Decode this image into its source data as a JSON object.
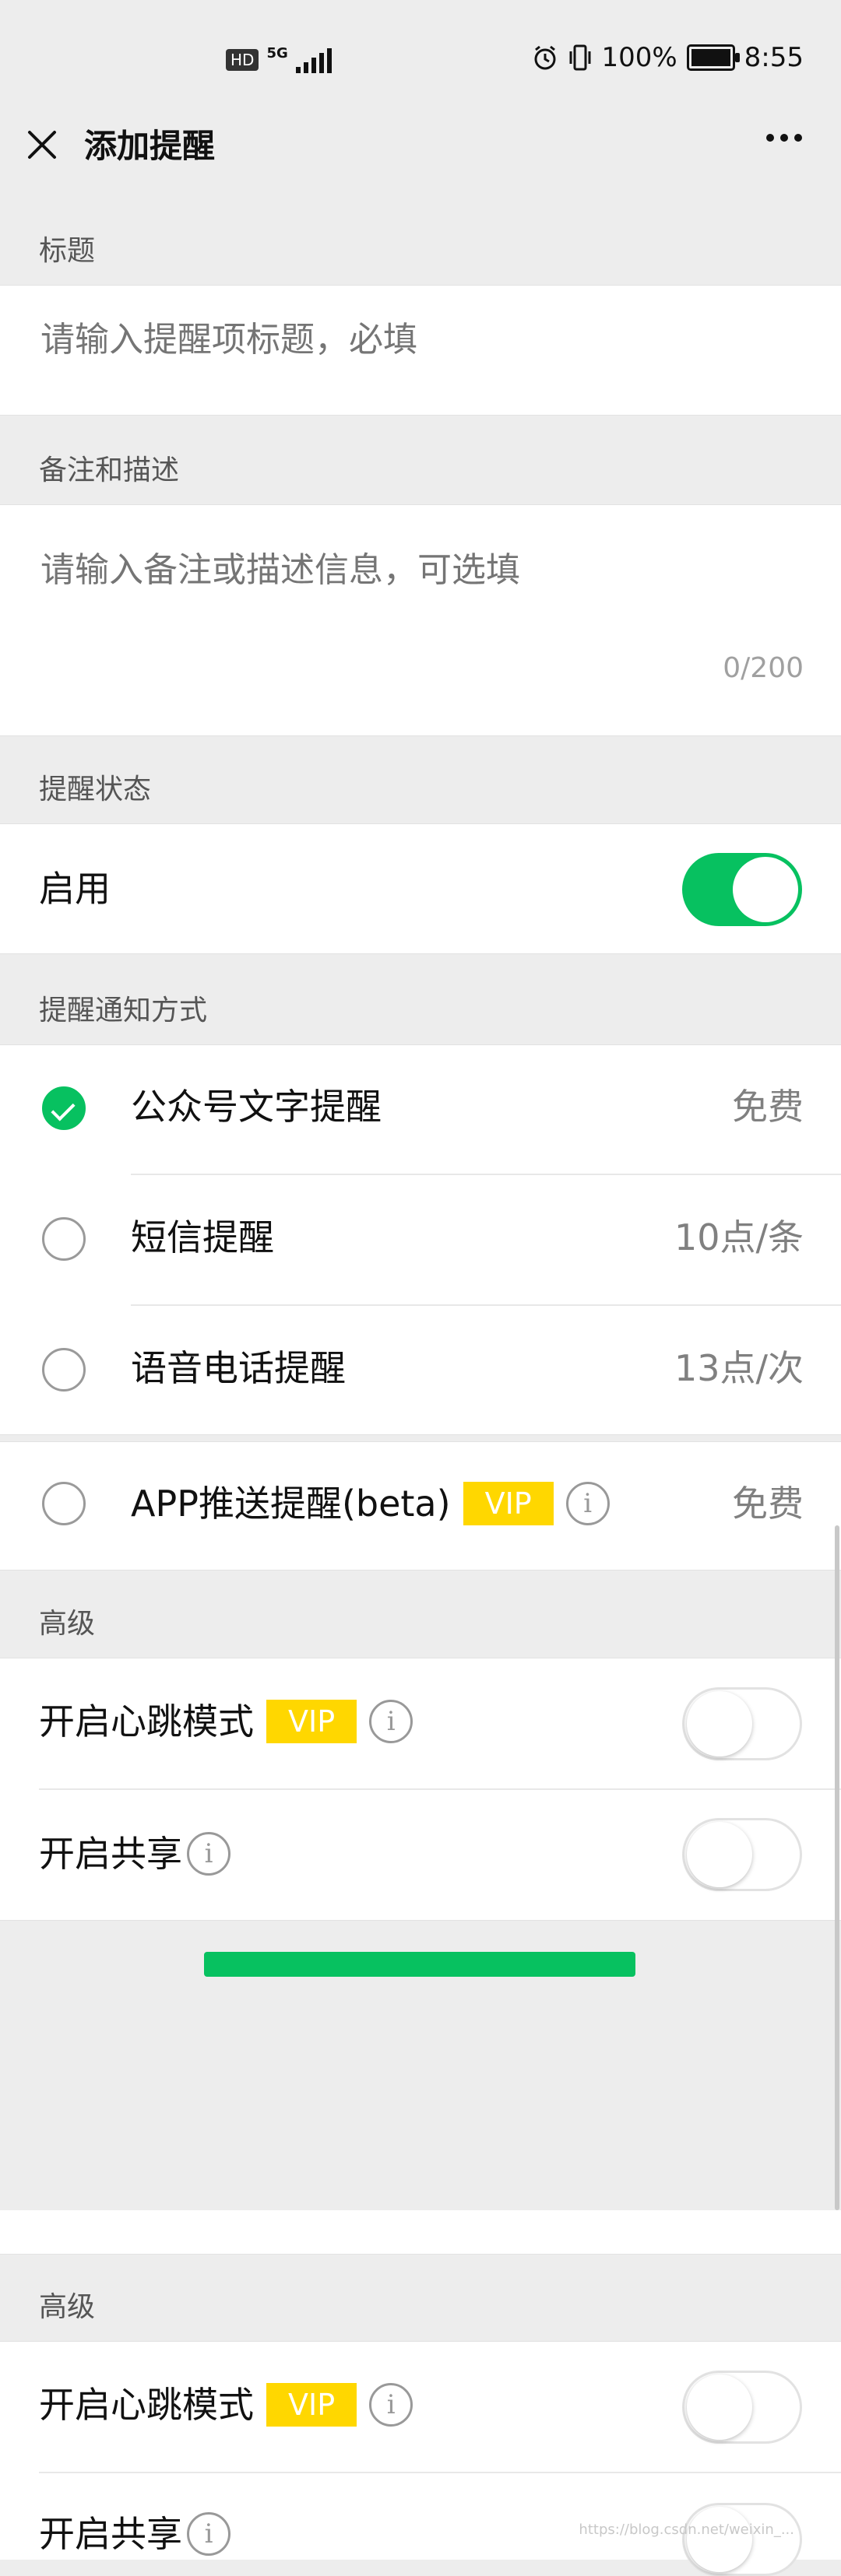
{
  "status_bar": {
    "hd": "HD",
    "network": "5G",
    "battery_text": "100%",
    "battery_level": 1.0,
    "time": "8:55"
  },
  "navbar": {
    "title": "添加提醒"
  },
  "title_section": {
    "label": "标题",
    "placeholder": "请输入提醒项标题，必填"
  },
  "notes_section": {
    "label": "备注和描述",
    "placeholder": "请输入备注或描述信息，可选填",
    "counter": "0/200"
  },
  "status_section": {
    "label": "提醒状态",
    "enable_label": "启用",
    "enabled": true
  },
  "notify_section": {
    "label": "提醒通知方式",
    "options": [
      {
        "label": "公众号文字提醒",
        "price": "免费",
        "checked": true
      },
      {
        "label": "短信提醒",
        "price": "10点/条",
        "checked": false
      },
      {
        "label": "语音电话提醒",
        "price": "13点/次",
        "checked": false
      },
      {
        "label": "APP推送提醒(beta)",
        "price": "免费",
        "checked": false,
        "badge": "VIP"
      }
    ]
  },
  "advanced_section": {
    "label": "高级",
    "heartbeat_label": "开启心跳模式",
    "heartbeat_badge": "VIP",
    "heartbeat_on": false,
    "share_label": "开启共享",
    "share_on": false
  },
  "icons": {
    "info_glyph": "i"
  },
  "watermark": "https://blog.csdn.net/weixin_..."
}
